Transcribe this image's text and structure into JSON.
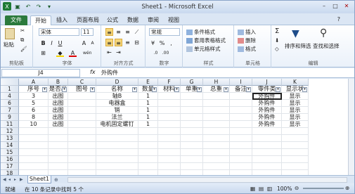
{
  "window": {
    "title": "Sheet1 - Microsoft Excel"
  },
  "qat": [
    "save-icon",
    "undo-icon",
    "redo-icon",
    "dropdown-icon"
  ],
  "tabs": [
    "文件",
    "开始",
    "插入",
    "页面布局",
    "公式",
    "数据",
    "审阅",
    "视图"
  ],
  "ribbon": {
    "clipboard": {
      "paste": "粘贴",
      "label": "剪贴板"
    },
    "font": {
      "name": "宋体",
      "size": "11",
      "label": "字体"
    },
    "alignment": {
      "label": "对齐方式"
    },
    "number": {
      "format": "常规",
      "label": "数字"
    },
    "styles": {
      "cond": "条件格式",
      "table": "套用表格格式",
      "cell": "单元格样式",
      "label": "样式"
    },
    "cells": {
      "insert": "插入",
      "delete": "删除",
      "format": "格式",
      "label": "单元格"
    },
    "editing": {
      "sort": "排序和筛选",
      "find": "查找和选择",
      "label": "编辑"
    }
  },
  "formula_bar": {
    "name_box": "J4",
    "fx": "fx",
    "value": "外购件"
  },
  "columns": [
    "A",
    "B",
    "C",
    "D",
    "E",
    "F",
    "G",
    "H",
    "I",
    "J",
    "K"
  ],
  "header_row": [
    "序号",
    "是否出",
    "图号",
    "名称",
    "数量",
    "材料",
    "单重",
    "总重",
    "备注",
    "零件类",
    "显示状"
  ],
  "rows": [
    {
      "num": "1",
      "cells": [
        "序号",
        "是否出",
        "图号",
        "名称",
        "数量",
        "材料",
        "单重",
        "总重",
        "备注",
        "零件类",
        "显示状"
      ]
    },
    {
      "num": "4",
      "cells": [
        "3",
        "出图",
        "",
        "轴B",
        "1",
        "",
        "",
        "",
        "",
        "外购件",
        "显示"
      ]
    },
    {
      "num": "6",
      "cells": [
        "5",
        "出图",
        "",
        "电器盒",
        "1",
        "",
        "",
        "",
        "",
        "外购件",
        "显示"
      ]
    },
    {
      "num": "7",
      "cells": [
        "6",
        "出图",
        "",
        "销",
        "1",
        "",
        "",
        "",
        "",
        "外购件",
        "显示"
      ]
    },
    {
      "num": "9",
      "cells": [
        "8",
        "出图",
        "",
        "法兰",
        "1",
        "",
        "",
        "",
        "",
        "外购件",
        "显示"
      ]
    },
    {
      "num": "11",
      "cells": [
        "10",
        "出图",
        "",
        "电机固定螺钉",
        "1",
        "",
        "",
        "",
        "",
        "外购件",
        "显示"
      ]
    },
    {
      "num": "12",
      "cells": [
        "",
        "",
        "",
        "",
        "",
        "",
        "",
        "",
        "",
        "",
        ""
      ]
    },
    {
      "num": "13",
      "cells": [
        "",
        "",
        "",
        "",
        "",
        "",
        "",
        "",
        "",
        "",
        ""
      ]
    },
    {
      "num": "14",
      "cells": [
        "",
        "",
        "",
        "",
        "",
        "",
        "",
        "",
        "",
        "",
        ""
      ]
    },
    {
      "num": "15",
      "cells": [
        "",
        "",
        "",
        "",
        "",
        "",
        "",
        "",
        "",
        "",
        ""
      ]
    },
    {
      "num": "16",
      "cells": [
        "",
        "",
        "",
        "",
        "",
        "",
        "",
        "",
        "",
        "",
        ""
      ]
    },
    {
      "num": "17",
      "cells": [
        "",
        "",
        "",
        "",
        "",
        "",
        "",
        "",
        "",
        "",
        ""
      ]
    },
    {
      "num": "18",
      "cells": [
        "",
        "",
        "",
        "",
        "",
        "",
        "",
        "",
        "",
        "",
        ""
      ]
    }
  ],
  "sheet_tab": "Sheet1",
  "status": {
    "mode": "就绪",
    "info": "在 10 条记录中找到 5 个",
    "zoom": "100%"
  }
}
